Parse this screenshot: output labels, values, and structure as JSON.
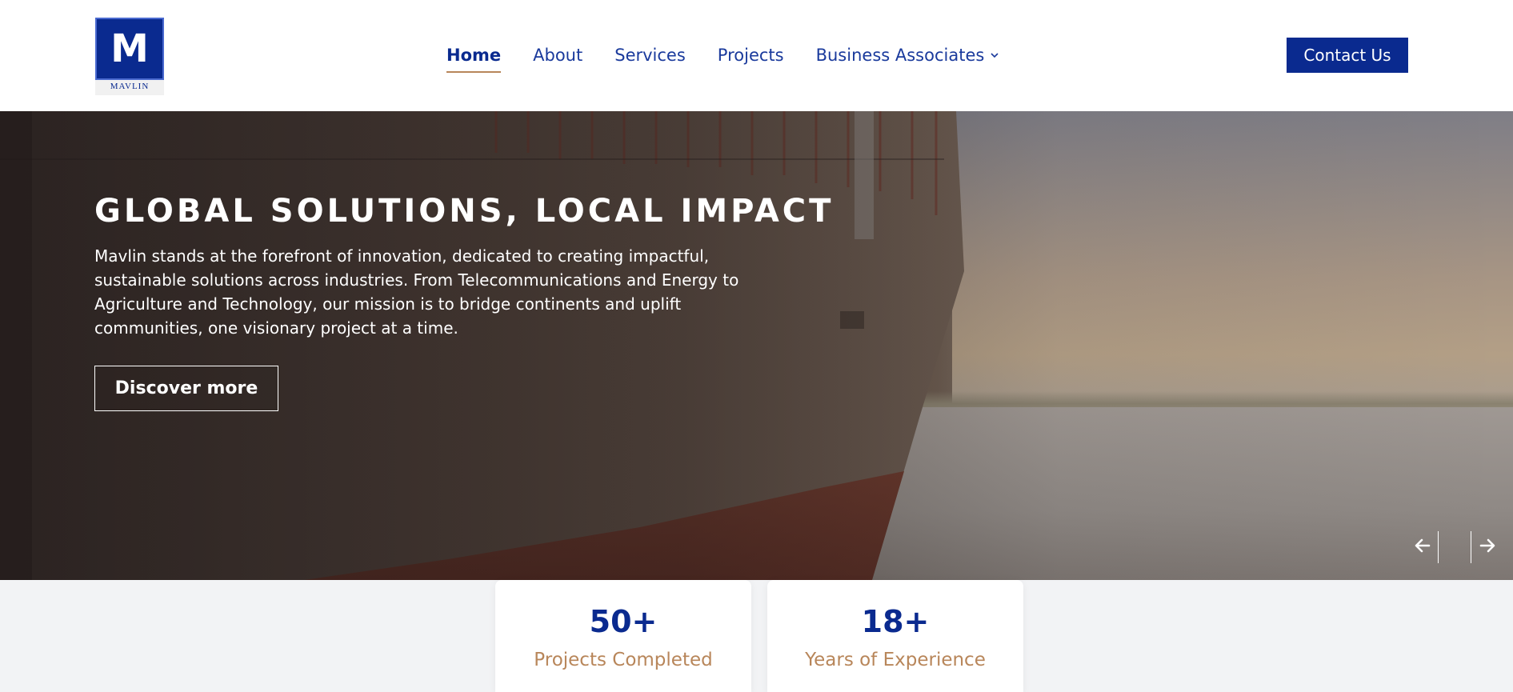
{
  "brand": {
    "logo_letter": "M",
    "logo_word": "MAVLIN"
  },
  "nav": {
    "items": [
      {
        "label": "Home",
        "active": true
      },
      {
        "label": "About",
        "active": false
      },
      {
        "label": "Services",
        "active": false
      },
      {
        "label": "Projects",
        "active": false
      },
      {
        "label": "Business Associates",
        "active": false,
        "has_dropdown": true,
        "dropdown_icon": "chevron-down-icon"
      }
    ]
  },
  "header": {
    "contact_label": "Contact Us"
  },
  "hero": {
    "title": "GLOBAL SOLUTIONS, LOCAL IMPACT",
    "description": "Mavlin stands at the forefront of innovation, dedicated to creating impactful, sustainable solutions across industries. From Telecommunications and Energy to Agriculture and Technology, our mission is to bridge continents and uplift communities, one visionary project at a time.",
    "cta_label": "Discover more",
    "prev_icon": "arrow-left-icon",
    "next_icon": "arrow-right-icon"
  },
  "stats": [
    {
      "value": "50+",
      "label": "Projects Completed"
    },
    {
      "value": "18+",
      "label": "Years of Experience"
    }
  ],
  "colors": {
    "brand_blue": "#0a2a8f",
    "nav_text": "#1a3a9c",
    "accent_gold": "#b8865a",
    "background": "#f2f3f5"
  }
}
